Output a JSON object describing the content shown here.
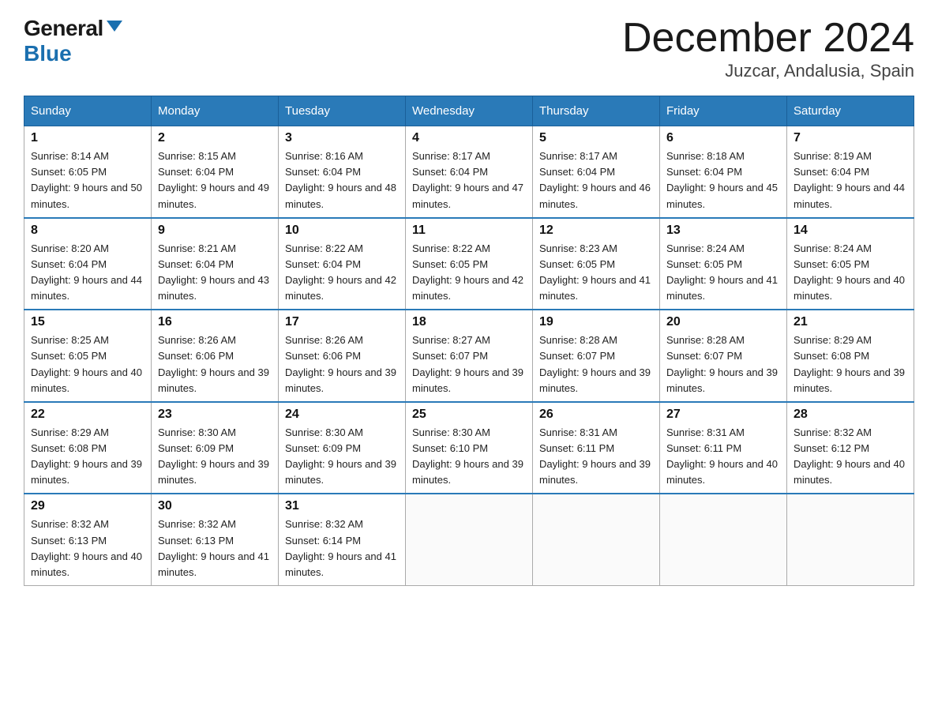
{
  "header": {
    "logo_general": "General",
    "logo_blue": "Blue",
    "month_title": "December 2024",
    "location": "Juzcar, Andalusia, Spain"
  },
  "weekdays": [
    "Sunday",
    "Monday",
    "Tuesday",
    "Wednesday",
    "Thursday",
    "Friday",
    "Saturday"
  ],
  "weeks": [
    [
      {
        "day": "1",
        "sunrise": "8:14 AM",
        "sunset": "6:05 PM",
        "daylight": "9 hours and 50 minutes."
      },
      {
        "day": "2",
        "sunrise": "8:15 AM",
        "sunset": "6:04 PM",
        "daylight": "9 hours and 49 minutes."
      },
      {
        "day": "3",
        "sunrise": "8:16 AM",
        "sunset": "6:04 PM",
        "daylight": "9 hours and 48 minutes."
      },
      {
        "day": "4",
        "sunrise": "8:17 AM",
        "sunset": "6:04 PM",
        "daylight": "9 hours and 47 minutes."
      },
      {
        "day": "5",
        "sunrise": "8:17 AM",
        "sunset": "6:04 PM",
        "daylight": "9 hours and 46 minutes."
      },
      {
        "day": "6",
        "sunrise": "8:18 AM",
        "sunset": "6:04 PM",
        "daylight": "9 hours and 45 minutes."
      },
      {
        "day": "7",
        "sunrise": "8:19 AM",
        "sunset": "6:04 PM",
        "daylight": "9 hours and 44 minutes."
      }
    ],
    [
      {
        "day": "8",
        "sunrise": "8:20 AM",
        "sunset": "6:04 PM",
        "daylight": "9 hours and 44 minutes."
      },
      {
        "day": "9",
        "sunrise": "8:21 AM",
        "sunset": "6:04 PM",
        "daylight": "9 hours and 43 minutes."
      },
      {
        "day": "10",
        "sunrise": "8:22 AM",
        "sunset": "6:04 PM",
        "daylight": "9 hours and 42 minutes."
      },
      {
        "day": "11",
        "sunrise": "8:22 AM",
        "sunset": "6:05 PM",
        "daylight": "9 hours and 42 minutes."
      },
      {
        "day": "12",
        "sunrise": "8:23 AM",
        "sunset": "6:05 PM",
        "daylight": "9 hours and 41 minutes."
      },
      {
        "day": "13",
        "sunrise": "8:24 AM",
        "sunset": "6:05 PM",
        "daylight": "9 hours and 41 minutes."
      },
      {
        "day": "14",
        "sunrise": "8:24 AM",
        "sunset": "6:05 PM",
        "daylight": "9 hours and 40 minutes."
      }
    ],
    [
      {
        "day": "15",
        "sunrise": "8:25 AM",
        "sunset": "6:05 PM",
        "daylight": "9 hours and 40 minutes."
      },
      {
        "day": "16",
        "sunrise": "8:26 AM",
        "sunset": "6:06 PM",
        "daylight": "9 hours and 39 minutes."
      },
      {
        "day": "17",
        "sunrise": "8:26 AM",
        "sunset": "6:06 PM",
        "daylight": "9 hours and 39 minutes."
      },
      {
        "day": "18",
        "sunrise": "8:27 AM",
        "sunset": "6:07 PM",
        "daylight": "9 hours and 39 minutes."
      },
      {
        "day": "19",
        "sunrise": "8:28 AM",
        "sunset": "6:07 PM",
        "daylight": "9 hours and 39 minutes."
      },
      {
        "day": "20",
        "sunrise": "8:28 AM",
        "sunset": "6:07 PM",
        "daylight": "9 hours and 39 minutes."
      },
      {
        "day": "21",
        "sunrise": "8:29 AM",
        "sunset": "6:08 PM",
        "daylight": "9 hours and 39 minutes."
      }
    ],
    [
      {
        "day": "22",
        "sunrise": "8:29 AM",
        "sunset": "6:08 PM",
        "daylight": "9 hours and 39 minutes."
      },
      {
        "day": "23",
        "sunrise": "8:30 AM",
        "sunset": "6:09 PM",
        "daylight": "9 hours and 39 minutes."
      },
      {
        "day": "24",
        "sunrise": "8:30 AM",
        "sunset": "6:09 PM",
        "daylight": "9 hours and 39 minutes."
      },
      {
        "day": "25",
        "sunrise": "8:30 AM",
        "sunset": "6:10 PM",
        "daylight": "9 hours and 39 minutes."
      },
      {
        "day": "26",
        "sunrise": "8:31 AM",
        "sunset": "6:11 PM",
        "daylight": "9 hours and 39 minutes."
      },
      {
        "day": "27",
        "sunrise": "8:31 AM",
        "sunset": "6:11 PM",
        "daylight": "9 hours and 40 minutes."
      },
      {
        "day": "28",
        "sunrise": "8:32 AM",
        "sunset": "6:12 PM",
        "daylight": "9 hours and 40 minutes."
      }
    ],
    [
      {
        "day": "29",
        "sunrise": "8:32 AM",
        "sunset": "6:13 PM",
        "daylight": "9 hours and 40 minutes."
      },
      {
        "day": "30",
        "sunrise": "8:32 AM",
        "sunset": "6:13 PM",
        "daylight": "9 hours and 41 minutes."
      },
      {
        "day": "31",
        "sunrise": "8:32 AM",
        "sunset": "6:14 PM",
        "daylight": "9 hours and 41 minutes."
      },
      null,
      null,
      null,
      null
    ]
  ]
}
